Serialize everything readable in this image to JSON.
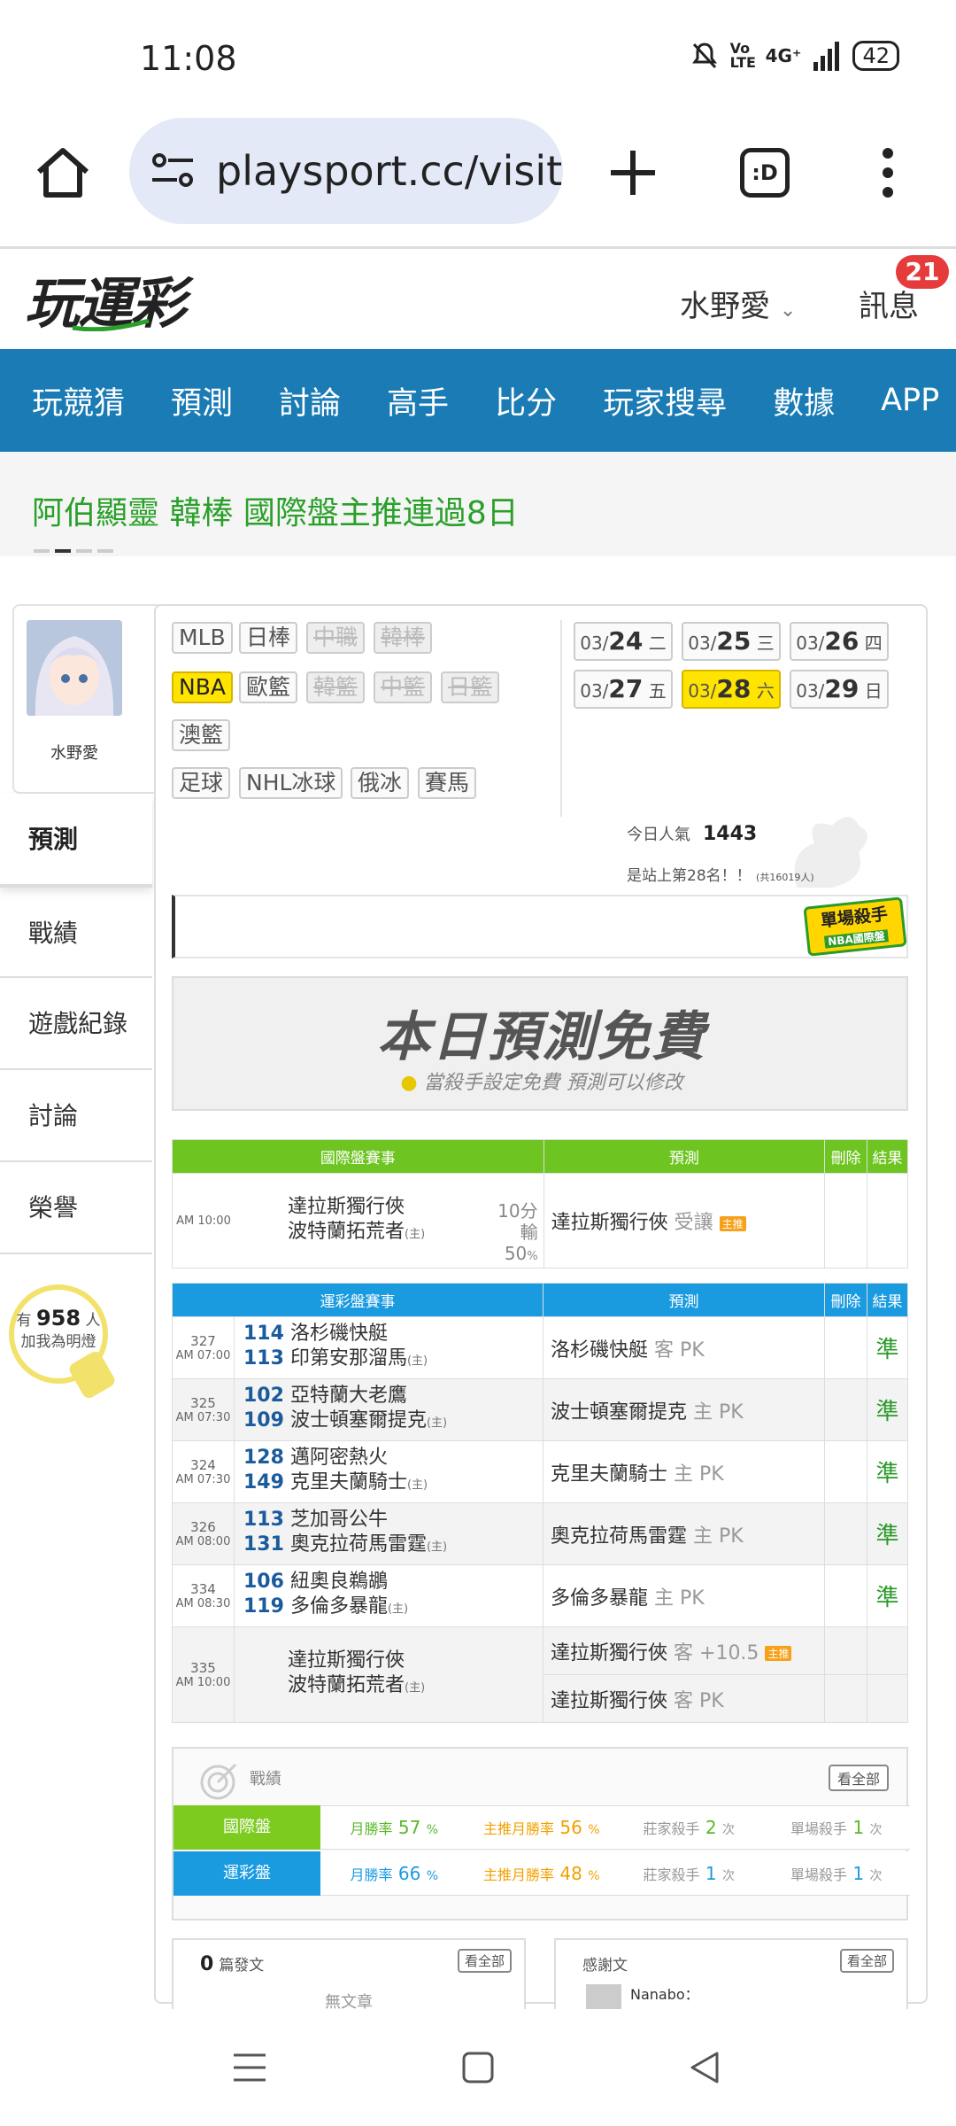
{
  "status_bar": {
    "time": "11:08",
    "network": "4G⁺",
    "signal": "Vo LTE",
    "battery": "42"
  },
  "browser": {
    "url": "playsport.cc/visit",
    "tabs_label": ":D"
  },
  "site": {
    "logo": "玩運彩",
    "user": "水野愛",
    "messages": "訊息",
    "message_count": "21"
  },
  "nav": [
    "玩競猜",
    "預測",
    "討論",
    "高手",
    "比分",
    "玩家搜尋",
    "數據",
    "APP"
  ],
  "banner": {
    "text": "阿伯顯靈 韓棒 國際盤主推連過8日"
  },
  "sidebar": {
    "avatar_name": "水野愛",
    "items": [
      "預測",
      "戰績",
      "遊戲紀錄",
      "討論",
      "榮譽"
    ],
    "fans_prefix": "有",
    "fans_count": "958",
    "fans_suffix": "人",
    "fans_cta": "加我為明燈"
  },
  "sports": {
    "row1": [
      "MLB",
      "日棒",
      "中職",
      "韓棒"
    ],
    "row2": [
      "NBA",
      "歐籃",
      "韓籃",
      "中籃",
      "日籃"
    ],
    "row3": [
      "澳籃"
    ],
    "row4": [
      "足球",
      "NHL冰球",
      "俄冰",
      "賽馬"
    ]
  },
  "dates": [
    {
      "md": "03/",
      "d": "24",
      "w": "二"
    },
    {
      "md": "03/",
      "d": "25",
      "w": "三"
    },
    {
      "md": "03/",
      "d": "26",
      "w": "四"
    },
    {
      "md": "03/",
      "d": "27",
      "w": "五"
    },
    {
      "md": "03/",
      "d": "28",
      "w": "六"
    },
    {
      "md": "03/",
      "d": "29",
      "w": "日"
    }
  ],
  "popularity": {
    "label": "今日人氣",
    "value": "1443",
    "rank": "是站上第28名！！",
    "rank_total": "(共16019人)"
  },
  "killer_tag": {
    "line1": "單場殺手",
    "line2": "NBA國際盤"
  },
  "free_banner": {
    "title": "本日預測免費",
    "subtitle": "當殺手設定免費 預測可以修改"
  },
  "intl_table": {
    "headers": [
      "國際盤賽事",
      "預測",
      "刪除",
      "結果"
    ],
    "row": {
      "time": "AM 10:00",
      "away": "達拉斯獨行俠",
      "home": "波特蘭拓荒者",
      "home_mark": "(主)",
      "odds": "10分輸",
      "odds_pct": "50",
      "pct": "%",
      "pick": "達拉斯獨行俠",
      "pick_type": "受讓",
      "pick_tag": "主推"
    }
  },
  "lottery_table": {
    "headers": [
      "運彩盤賽事",
      "預測",
      "刪除",
      "結果"
    ],
    "rows": [
      {
        "game": "327",
        "time": "AM 07:00",
        "n1": "114",
        "t1": "洛杉磯快艇",
        "n2": "113",
        "t2": "印第安那溜馬",
        "pick": "洛杉磯快艇",
        "pick_side": "客 PK",
        "result": "準"
      },
      {
        "game": "325",
        "time": "AM 07:30",
        "n1": "102",
        "t1": "亞特蘭大老鷹",
        "n2": "109",
        "t2": "波士頓塞爾提克",
        "pick": "波士頓塞爾提克",
        "pick_side": "主 PK",
        "result": "準"
      },
      {
        "game": "324",
        "time": "AM 07:30",
        "n1": "128",
        "t1": "邁阿密熱火",
        "n2": "149",
        "t2": "克里夫蘭騎士",
        "pick": "克里夫蘭騎士",
        "pick_side": "主 PK",
        "result": "準"
      },
      {
        "game": "326",
        "time": "AM 08:00",
        "n1": "113",
        "t1": "芝加哥公牛",
        "n2": "131",
        "t2": "奧克拉荷馬雷霆",
        "pick": "奧克拉荷馬雷霆",
        "pick_side": "主 PK",
        "result": "準"
      },
      {
        "game": "334",
        "time": "AM 08:30",
        "n1": "106",
        "t1": "紐奧良鵜鶘",
        "n2": "119",
        "t2": "多倫多暴龍",
        "pick": "多倫多暴龍",
        "pick_side": "主 PK",
        "result": "準"
      }
    ],
    "last": {
      "game": "335",
      "time": "AM 10:00",
      "t1": "達拉斯獨行俠",
      "t2": "波特蘭拓荒者",
      "pick1": "達拉斯獨行俠",
      "pick1_side": "客 +10.5",
      "pick1_tag": "主推",
      "pick2": "達拉斯獨行俠",
      "pick2_side": "客 PK"
    },
    "home_mark": "(主)"
  },
  "record": {
    "title": "戰績",
    "view_all": "看全部",
    "rows": [
      {
        "label": "國際盤",
        "color": "#7ecb20",
        "win_rate": "月勝率",
        "v1": "57",
        "main_rate": "主推月勝率",
        "v2": "56",
        "banker": "莊家殺手",
        "v3": "2",
        "single": "單場殺手",
        "v4": "1",
        "pct": "%",
        "times": "次"
      },
      {
        "label": "運彩盤",
        "color": "#1a9be0",
        "win_rate": "月勝率",
        "v1": "66",
        "main_rate": "主推月勝率",
        "v2": "48",
        "banker": "莊家殺手",
        "v3": "1",
        "single": "單場殺手",
        "v4": "1",
        "pct": "%",
        "times": "次"
      }
    ]
  },
  "posts": {
    "count": "0",
    "label": "篇發文",
    "view_all": "看全部",
    "empty": "無文章"
  },
  "thanks": {
    "label": "感謝文",
    "view_all": "看全部",
    "user": "Nanabo："
  }
}
